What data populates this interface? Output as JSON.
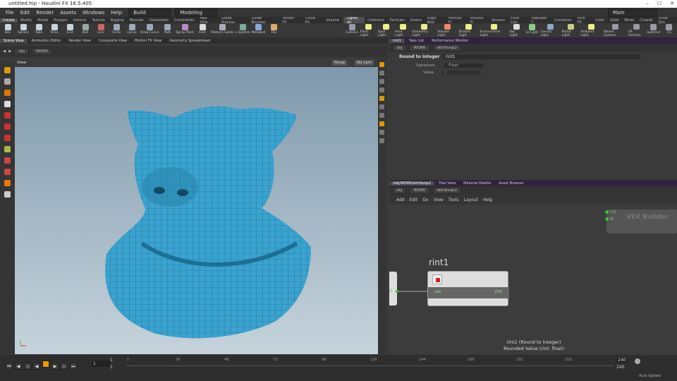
{
  "window": {
    "title": "untitled.hip - Houdini FX 16.5.405"
  },
  "menu": {
    "items": [
      "File",
      "Edit",
      "Render",
      "Assets",
      "Windows",
      "Help"
    ],
    "desktop": "Build",
    "mode": "Modeling",
    "main": "Main"
  },
  "shelf_tabs_left": [
    "Create",
    "Modify",
    "Model",
    "Polygon",
    "Deform",
    "Texture",
    "Rigging",
    "Muscles",
    "Characters",
    "Constraints",
    "Hair Utils",
    "Guide Process",
    "Guide Brushes",
    "Terrain FX",
    "Cloud FX",
    "Volume"
  ],
  "shelf_tabs_right": [
    "Lights an",
    "Collisions",
    "Particles",
    "Grains",
    "Rigid Bod",
    "Particle Fl",
    "Viscous Fl",
    "Oceans",
    "Fluid Con",
    "Populate C",
    "Container",
    "Pyro FX",
    "Cloth",
    "Solid",
    "Wires",
    "Crowds",
    "Drive Sim"
  ],
  "shelf_tools_left": [
    {
      "label": "Box",
      "color": "#c9d3dc"
    },
    {
      "label": "Sphere",
      "color": "#c9d3dc"
    },
    {
      "label": "Tube",
      "color": "#c9d3dc"
    },
    {
      "label": "Torus",
      "color": "#c9d3dc"
    },
    {
      "label": "Grid",
      "color": "#c9d3dc"
    },
    {
      "label": "Null",
      "color": "#9aa"
    },
    {
      "label": "Line",
      "color": "#c66"
    },
    {
      "label": "Circle",
      "color": "#9ab"
    },
    {
      "label": "Curve",
      "color": "#9ab"
    },
    {
      "label": "Draw Curve",
      "color": "#9ab"
    },
    {
      "label": "Path",
      "color": "#9ab"
    },
    {
      "label": "Spray Paint",
      "color": "#b8c"
    },
    {
      "label": "Font",
      "color": "#ddd"
    },
    {
      "label": "Platonic Solids",
      "color": "#aab"
    },
    {
      "label": "L-System",
      "color": "#7a9"
    },
    {
      "label": "Metaball",
      "color": "#8ad"
    },
    {
      "label": "File",
      "color": "#da6"
    }
  ],
  "shelf_tools_right": [
    {
      "label": "Camera",
      "color": "#99a"
    },
    {
      "label": "Point Light",
      "color": "#ee8"
    },
    {
      "label": "Spot Light",
      "color": "#ee8"
    },
    {
      "label": "Area Light",
      "color": "#ee8"
    },
    {
      "label": "Geometry Light",
      "color": "#ee8"
    },
    {
      "label": "Volume Light",
      "color": "#e86"
    },
    {
      "label": "Distant Light",
      "color": "#ee8"
    },
    {
      "label": "Environment Light",
      "color": "#ee8"
    },
    {
      "label": "Sky Light",
      "color": "#ddd"
    },
    {
      "label": "GI Light",
      "color": "#8c8"
    },
    {
      "label": "Caustic Light",
      "color": "#8ac"
    },
    {
      "label": "Portal Light",
      "color": "#cc8"
    },
    {
      "label": "Ambient Light",
      "color": "#ee8"
    },
    {
      "label": "Stereo Camera",
      "color": "#99a"
    },
    {
      "label": "VR Camera",
      "color": "#99a"
    },
    {
      "label": "Switcher",
      "color": "#99a"
    },
    {
      "label": "Ca",
      "color": "#99a"
    }
  ],
  "left_pane_tabs": [
    "Scene View",
    "Animation Editor",
    "Render View",
    "Composite View",
    "Motion FX View",
    "Geometry Spreadsheet"
  ],
  "path": {
    "obj": "obj",
    "work": "WORK",
    "node": "attribvop2"
  },
  "viewport": {
    "label": "View",
    "persp": "Persp",
    "cam": "No cam"
  },
  "params_tabs": [
    "rint1",
    "Take List",
    "Performance Monitor"
  ],
  "params": {
    "node_type": "Round to Integer",
    "node_name": "rint1",
    "signature_label": "Signature",
    "signature_value": "Float",
    "value_label": "Value",
    "value": "0"
  },
  "net_tabs": [
    "/obj/WORK/attribvop2",
    "Tree View",
    "Material Palette",
    "Asset Browser"
  ],
  "net_menu": [
    "Add",
    "Edit",
    "Go",
    "View",
    "Tools",
    "Layout",
    "Help"
  ],
  "network": {
    "node_label": "rint1",
    "in_port": "val",
    "out_port": "rint",
    "builder": "VEX Builder",
    "cd": "Cd",
    "n": "N",
    "left_port": "d",
    "info_line1": "rint1 (Round to Integer)",
    "info_line2": "Rounded Value (rint: float)"
  },
  "timeline": {
    "current": "1",
    "start": "1",
    "start2": "1",
    "end": "240",
    "end2": "240",
    "ticks": [
      "1",
      "24",
      "48",
      "72",
      "96",
      "120",
      "144",
      "168",
      "192",
      "216"
    ],
    "auto": "Auto Update"
  }
}
